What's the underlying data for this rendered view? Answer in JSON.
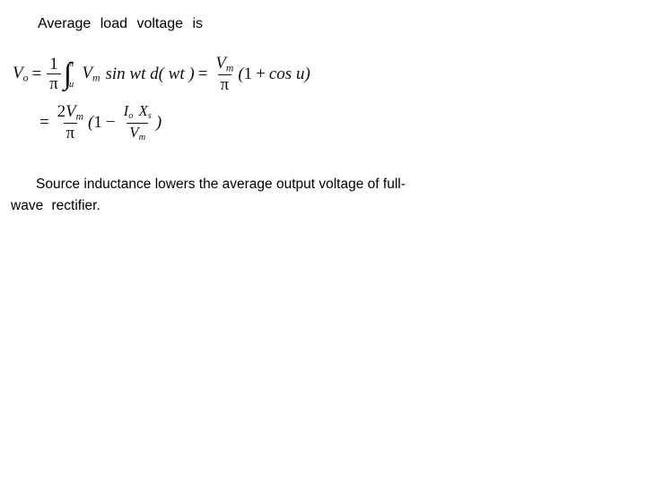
{
  "slide": {
    "background_color": "#ffffff",
    "text_color": "#000000",
    "heading": "Average  load  voltage  is",
    "paragraph_line1": "Source   inductance   lowers   the   average   output   voltage   of   full-",
    "paragraph_line2": "wave   rectifier.",
    "paragraph_full": "Source inductance lowers the average output voltage of full-wave rectifier."
  },
  "equation": {
    "line1": {
      "lhs_var": "V",
      "lhs_sub": "o",
      "eq1": "=",
      "coeff_num": "1",
      "coeff_den": "π",
      "integral_glyph": "∫",
      "integral_upper": "π",
      "integral_lower": "u",
      "integrand_var": "V",
      "integrand_sub": "m",
      "integrand_fn": "sin wt d( wt )",
      "eq2": "=",
      "rhs_num_var": "V",
      "rhs_num_sub": "m",
      "rhs_den": "π",
      "rhs_paren_open": "(",
      "rhs_one": "1",
      "rhs_plus": "+",
      "rhs_cos": "cos u",
      "rhs_paren_close": ")",
      "plain_text": "Vo = (1/π) ∫(u to π) Vm sin wt d(wt) = (Vm/π)(1 + cos u)"
    },
    "line2": {
      "eq": "=",
      "num_coeff": "2",
      "num_var": "V",
      "num_sub": "m",
      "den": "π",
      "paren_open": "(",
      "one": "1",
      "minus": "−",
      "inner_num_var1": "I",
      "inner_num_sub1": "o",
      "inner_num_var2": "X",
      "inner_num_sub2": "s",
      "inner_den_var": "V",
      "inner_den_sub": "m",
      "paren_close": ")",
      "plain_text": "= (2Vm/π)(1 − IoXs/Vm)"
    }
  }
}
